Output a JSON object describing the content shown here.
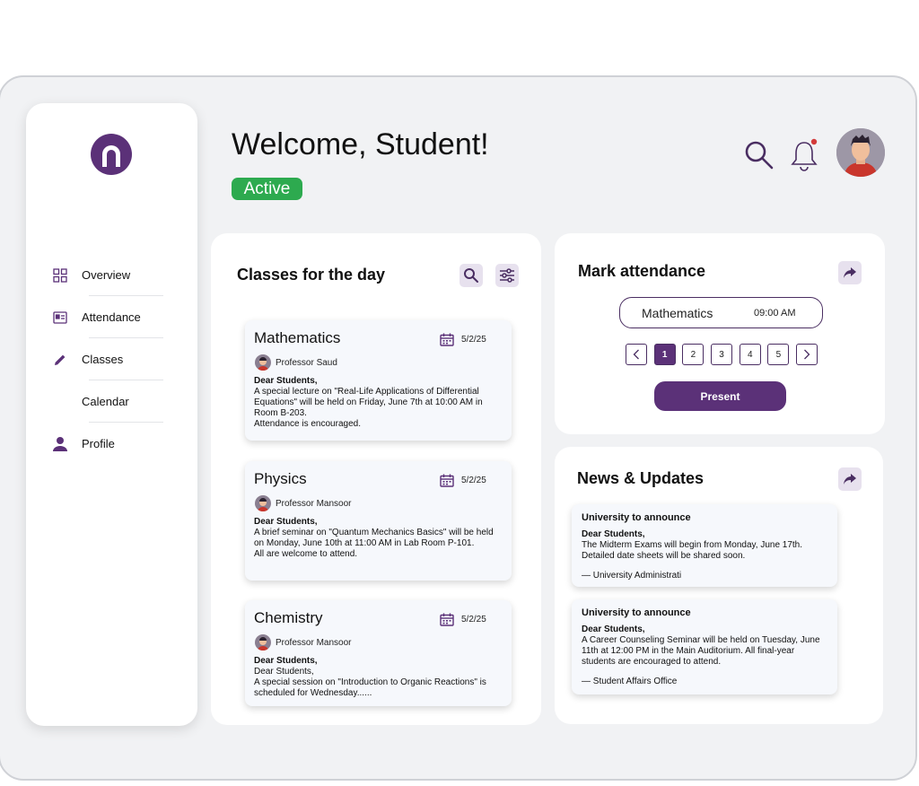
{
  "header": {
    "welcome": "Welcome, Student!",
    "status": "Active",
    "status_color": "#2daa4f",
    "icons": [
      "search-icon",
      "bell-icon",
      "avatar"
    ]
  },
  "sidebar": {
    "items": [
      {
        "label": "Overview",
        "icon": "grid-icon"
      },
      {
        "label": "Attendance",
        "icon": "id-card-icon"
      },
      {
        "label": "Classes",
        "icon": "pencil-icon"
      },
      {
        "label": "Calendar",
        "icon": ""
      },
      {
        "label": "Profile",
        "icon": "person-icon"
      }
    ]
  },
  "classes": {
    "title": "Classes for the day",
    "cards": [
      {
        "subject": "Mathematics",
        "date": "5/2/25",
        "professor": "Professor Saud",
        "greeting": "Dear Students,",
        "body": "A special lecture on \"Real-Life Applications of Differential Equations\" will be held on Friday, June 7th at 10:00 AM in Room B-203.",
        "footer": "Attendance is encouraged."
      },
      {
        "subject": "Physics",
        "date": "5/2/25",
        "professor": "Professor Mansoor",
        "greeting": "Dear Students,",
        "body": "A brief seminar on \"Quantum Mechanics Basics\" will be held on Monday, June 10th at 11:00 AM in Lab Room P-101.",
        "footer": "All are welcome to attend."
      },
      {
        "subject": "Chemistry",
        "date": "5/2/25",
        "professor": "Professor Mansoor",
        "greeting": "Dear Students,",
        "body": "Dear Students,",
        "footer": "A special session on \"Introduction to Organic Reactions\" is scheduled for Wednesday......"
      }
    ]
  },
  "attendance": {
    "title": "Mark attendance",
    "subject": "Mathematics",
    "time": "09:00 AM",
    "pages": [
      "1",
      "2",
      "3",
      "4",
      "5"
    ],
    "active_page": "1",
    "prev": "<",
    "next": ">",
    "present_label": "Present",
    "accent": "#5b3178"
  },
  "news": {
    "title": "News & Updates",
    "cards": [
      {
        "title": "University to announce",
        "greeting": "Dear Students,",
        "body": "The Midterm Exams will begin from Monday, June 17th. Detailed date sheets will be shared soon.",
        "signature": "— University Administrati"
      },
      {
        "title": "University to announce",
        "greeting": "Dear Students,",
        "body": "A Career Counseling Seminar will be held on Tuesday, June 11th at 12:00 PM in the Main Auditorium. All final-year students are encouraged to attend.",
        "signature": "— Student Affairs Office"
      }
    ]
  }
}
